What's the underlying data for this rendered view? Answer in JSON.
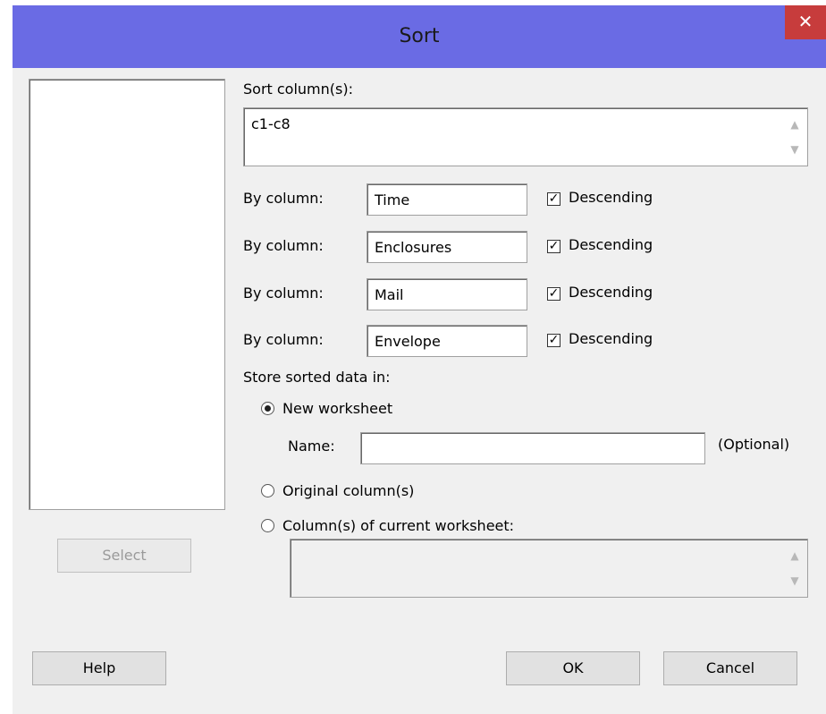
{
  "window": {
    "title": "Sort",
    "close_glyph": "✕"
  },
  "left": {
    "select_label": "Select"
  },
  "sort_columns": {
    "label": "Sort column(s):",
    "value": "c1-c8"
  },
  "by_columns": [
    {
      "label": "By column:",
      "value": "Time",
      "descending_label": "Descending",
      "descending_checked": true
    },
    {
      "label": "By column:",
      "value": "Enclosures",
      "descending_label": "Descending",
      "descending_checked": true
    },
    {
      "label": "By column:",
      "value": "Mail",
      "descending_label": "Descending",
      "descending_checked": true
    },
    {
      "label": "By column:",
      "value": "Envelope",
      "descending_label": "Descending",
      "descending_checked": true
    }
  ],
  "store": {
    "label": "Store sorted data in:",
    "new_worksheet_label": "New worksheet",
    "name_label": "Name:",
    "name_value": "",
    "optional_label": "(Optional)",
    "original_columns_label": "Original column(s)",
    "current_worksheet_label": "Column(s) of current worksheet:",
    "selected": "new_worksheet"
  },
  "footer": {
    "help_label": "Help",
    "ok_label": "OK",
    "cancel_label": "Cancel"
  },
  "glyphs": {
    "check": "✓",
    "scroll_up": "▲",
    "scroll_down": "▼"
  },
  "colors": {
    "titlebar": "#6a6be4",
    "close": "#c73c3c",
    "dialog_bg": "#f0f0f0"
  }
}
